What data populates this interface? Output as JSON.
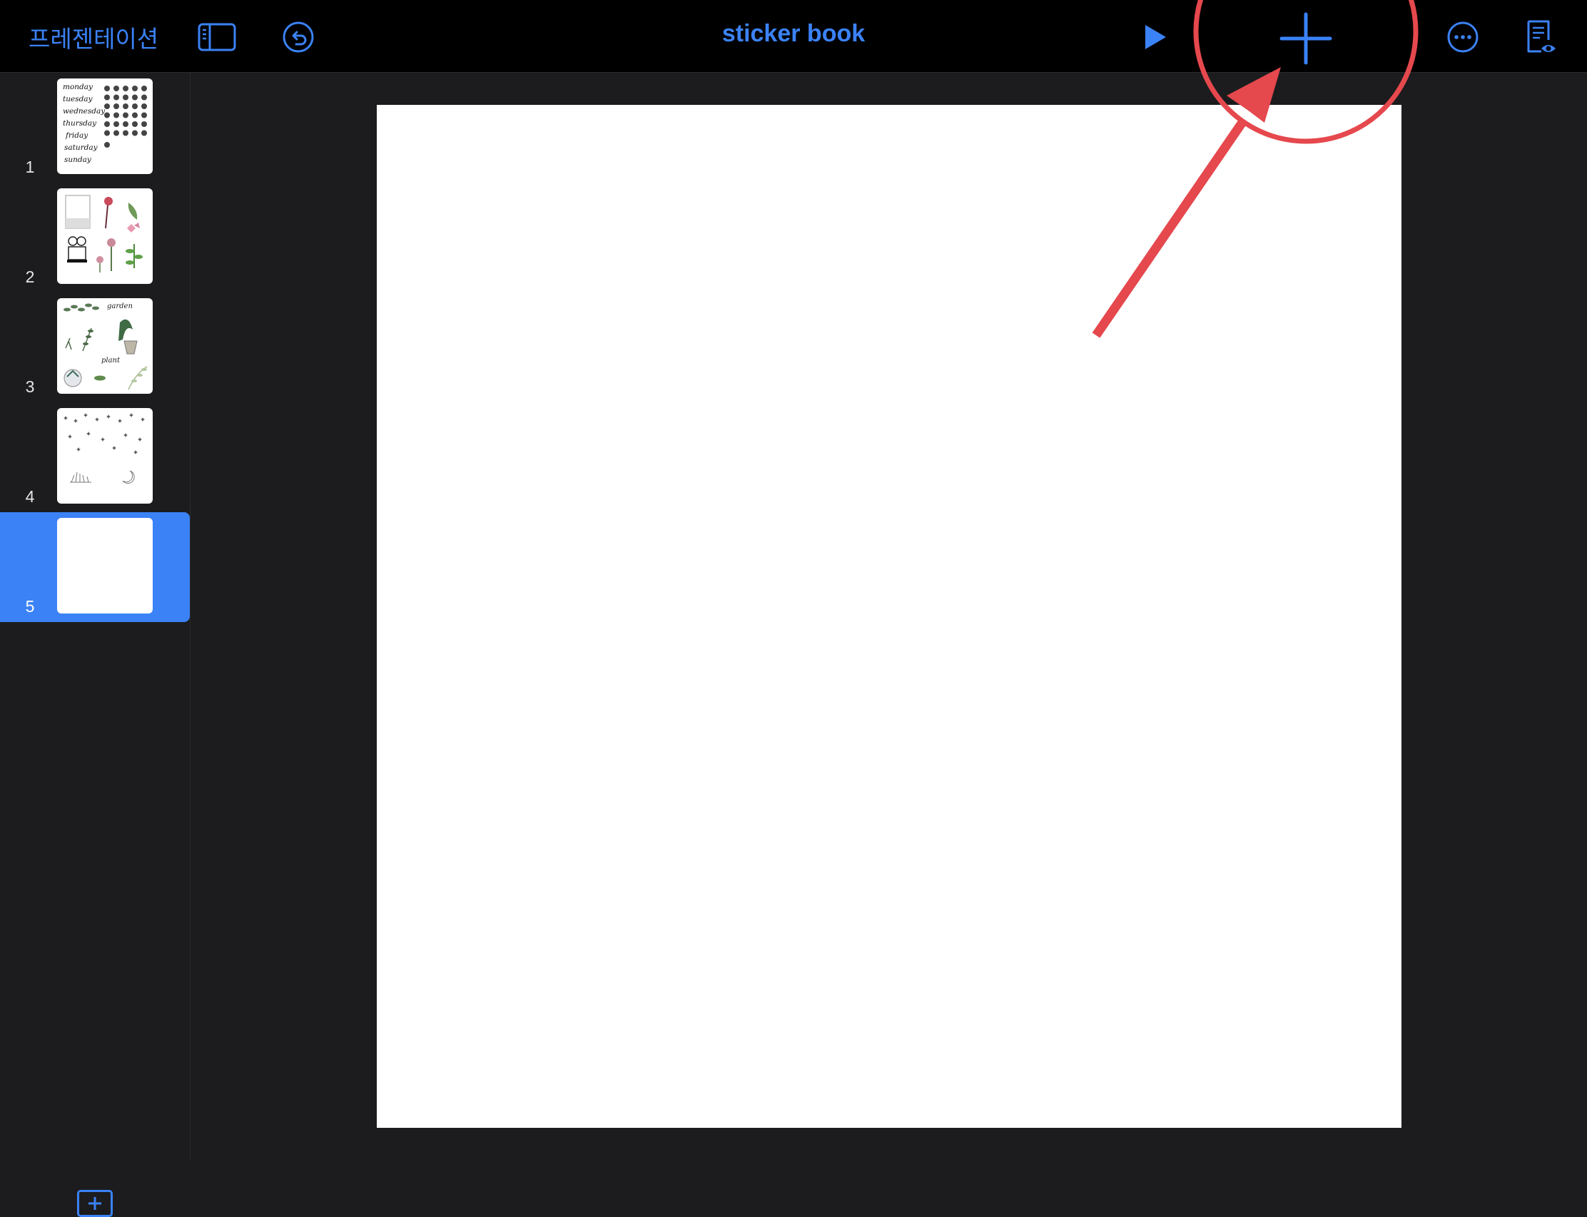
{
  "toolbar": {
    "back_label": "프레젠테이션",
    "document_title": "sticker book",
    "icons": [
      "sidebar-toggle-icon",
      "undo-icon",
      "play-icon",
      "plus-icon",
      "more-icon",
      "presenter-notes-icon"
    ]
  },
  "sidebar": {
    "slides": [
      {
        "number": "1",
        "selected": false
      },
      {
        "number": "2",
        "selected": false
      },
      {
        "number": "3",
        "selected": false
      },
      {
        "number": "4",
        "selected": false
      },
      {
        "number": "5",
        "selected": true
      }
    ],
    "thumb1_text": {
      "days": [
        "monday",
        "tuesday",
        "wednesday",
        "thursday",
        "friday",
        "saturday",
        "sunday"
      ]
    },
    "thumb3_text": {
      "word1": "garden",
      "word2": "plant"
    }
  },
  "colors": {
    "accent": "#3b82f6",
    "highlight": "#e5484d",
    "toolbar_bg": "#000000",
    "sidebar_bg": "#1c1c1e"
  }
}
